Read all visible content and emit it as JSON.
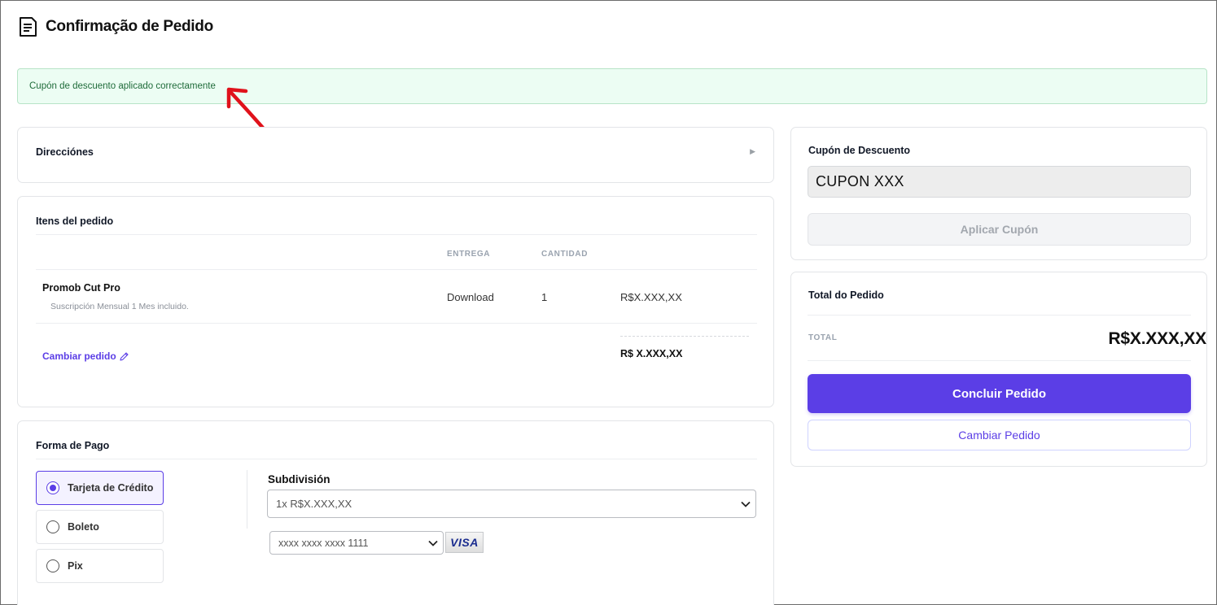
{
  "header": {
    "title": "Confirmação de Pedido",
    "icon": "document-icon"
  },
  "alert": {
    "message": "Cupón de descuento aplicado correctamente"
  },
  "addresses": {
    "title": "Direcciónes"
  },
  "order_items": {
    "title": "Itens del pedido",
    "columns": {
      "delivery": "ENTREGA",
      "quantity": "CANTIDAD"
    },
    "items": [
      {
        "name": "Promob Cut Pro",
        "description": "Suscripción Mensual 1 Mes incluido.",
        "delivery": "Download",
        "quantity": "1",
        "price": "R$X.XXX,XX"
      }
    ],
    "subtotal": "R$ X.XXX,XX",
    "change_link": "Cambiar pedido"
  },
  "payment": {
    "title": "Forma de Pago",
    "options": [
      {
        "label": "Tarjeta de Crédito",
        "selected": true
      },
      {
        "label": "Boleto",
        "selected": false
      },
      {
        "label": "Pix",
        "selected": false
      }
    ],
    "subdivision_label": "Subdivisión",
    "installment_value": "1x R$X.XXX,XX",
    "card_value": "xxxx xxxx xxxx 1111",
    "card_brand": "VISA"
  },
  "coupon": {
    "title": "Cupón de Descuento",
    "value": "CUPON XXX",
    "apply_label": "Aplicar Cupón"
  },
  "order_total": {
    "title": "Total do Pedido",
    "total_label": "TOTAL",
    "total_value": "R$X.XXX,XX",
    "conclude_label": "Concluir Pedido",
    "change_label": "Cambiar Pedido"
  },
  "colors": {
    "accent": "#5b3ee6",
    "success_bg": "#ecfdf3",
    "success_text": "#1f6b3a",
    "annotation": "#e0121b"
  }
}
